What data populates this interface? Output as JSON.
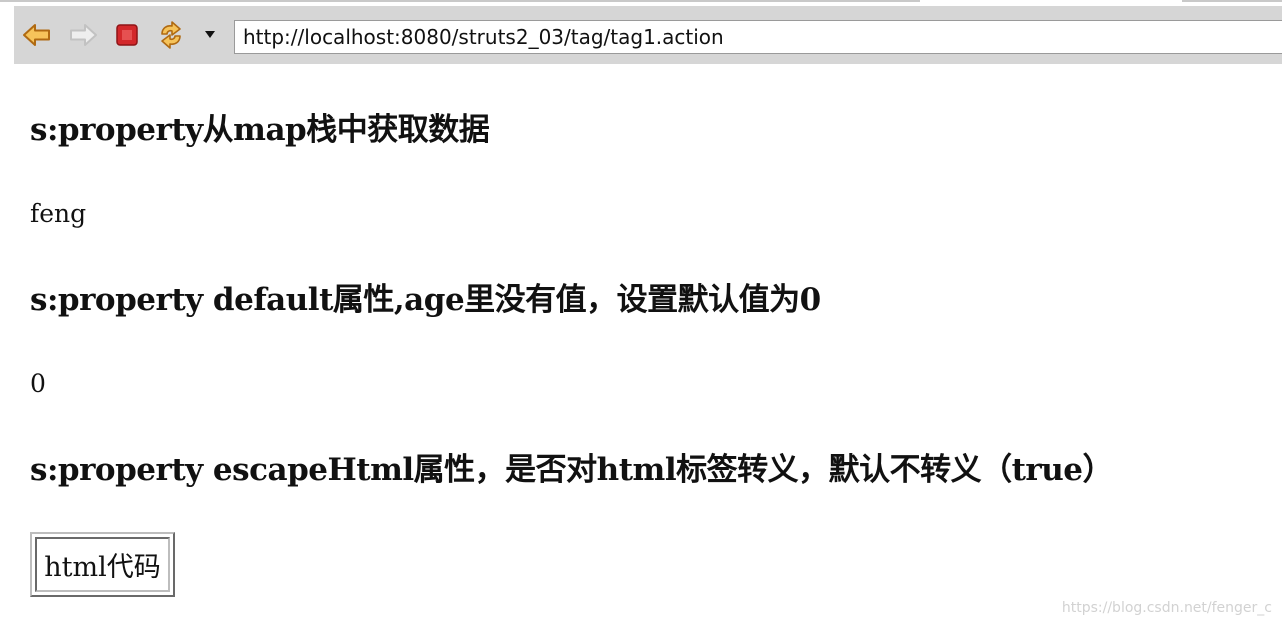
{
  "browser": {
    "url": "http://localhost:8080/struts2_03/tag/tag1.action",
    "buttons": {
      "back": "back-arrow-icon",
      "forward": "forward-arrow-icon",
      "stop": "stop-icon",
      "refresh": "refresh-icon",
      "menu": "dropdown-triangle-icon"
    }
  },
  "page": {
    "sections": [
      {
        "heading": "s:property从map栈中获取数据",
        "value": "feng"
      },
      {
        "heading": "s:property default属性,age里没有值，设置默认值为0",
        "value": "0"
      },
      {
        "heading": "s:property escapeHtml属性，是否对html标签转义，默认不转义（true）",
        "value": "html代码"
      }
    ]
  },
  "watermark": "https://blog.csdn.net/fenger_c",
  "colors": {
    "toolbar": "#d6d6d6",
    "arrow_fill": "#f6c35a",
    "arrow_stroke": "#b06a12",
    "stop_fill": "#d3282b",
    "forward_disabled": "#c9c9c9"
  }
}
